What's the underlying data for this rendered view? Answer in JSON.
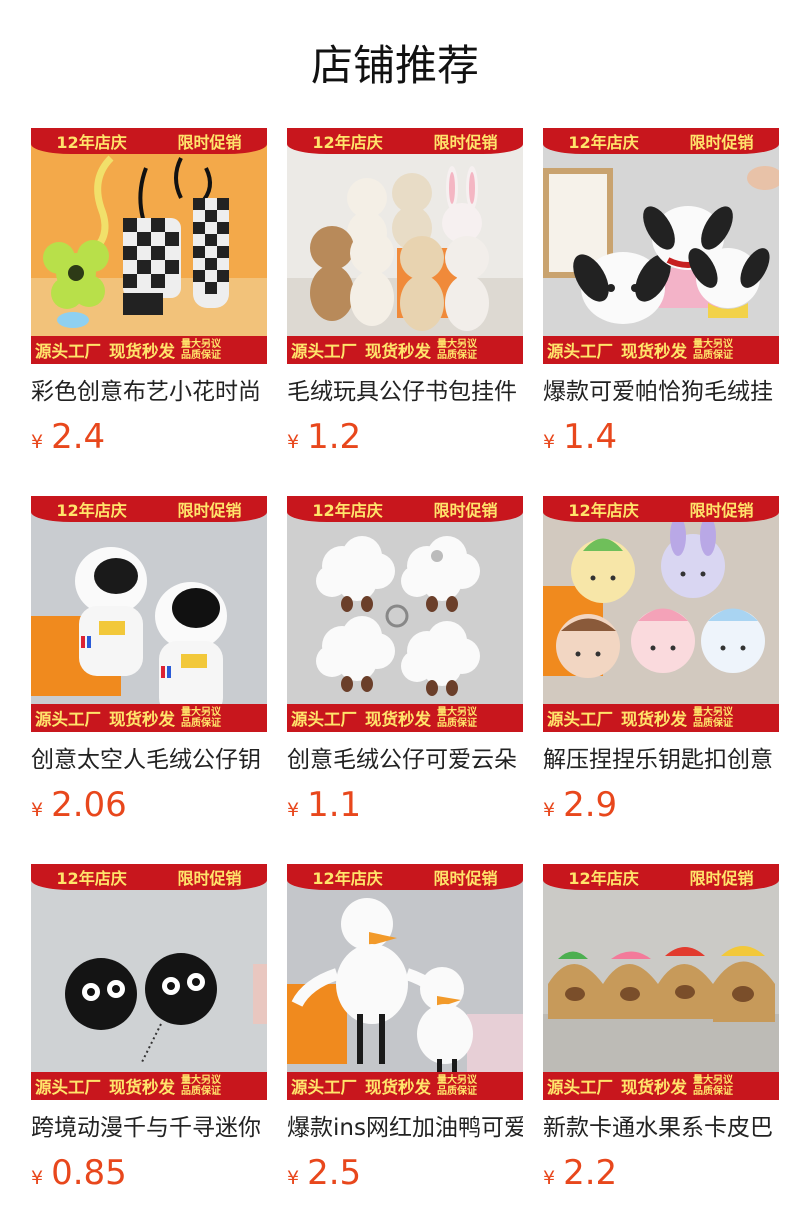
{
  "page": {
    "title": "店铺推荐"
  },
  "banner": {
    "top_left": "12年店庆",
    "top_right": "限时促销",
    "bottom_left": "源头工厂",
    "bottom_mid": "现货秒发",
    "bottom_small_1": "量大另议",
    "bottom_small_2": "品质保证"
  },
  "currency": "¥",
  "accent_color": "#e8471c",
  "banner_color": "#c8161d",
  "products": [
    {
      "title": "彩色创意布艺小花时尚",
      "price": "2.4"
    },
    {
      "title": "毛绒玩具公仔书包挂件",
      "price": "1.2"
    },
    {
      "title": "爆款可爱帕恰狗毛绒挂",
      "price": "1.4"
    },
    {
      "title": "创意太空人毛绒公仔钥",
      "price": "2.06"
    },
    {
      "title": "创意毛绒公仔可爱云朵",
      "price": "1.1"
    },
    {
      "title": "解压捏捏乐钥匙扣创意",
      "price": "2.9"
    },
    {
      "title": "跨境动漫千与千寻迷你",
      "price": "0.85"
    },
    {
      "title": "爆款ins网红加油鸭可爱",
      "price": "2.5"
    },
    {
      "title": "新款卡通水果系卡皮巴",
      "price": "2.2"
    }
  ]
}
